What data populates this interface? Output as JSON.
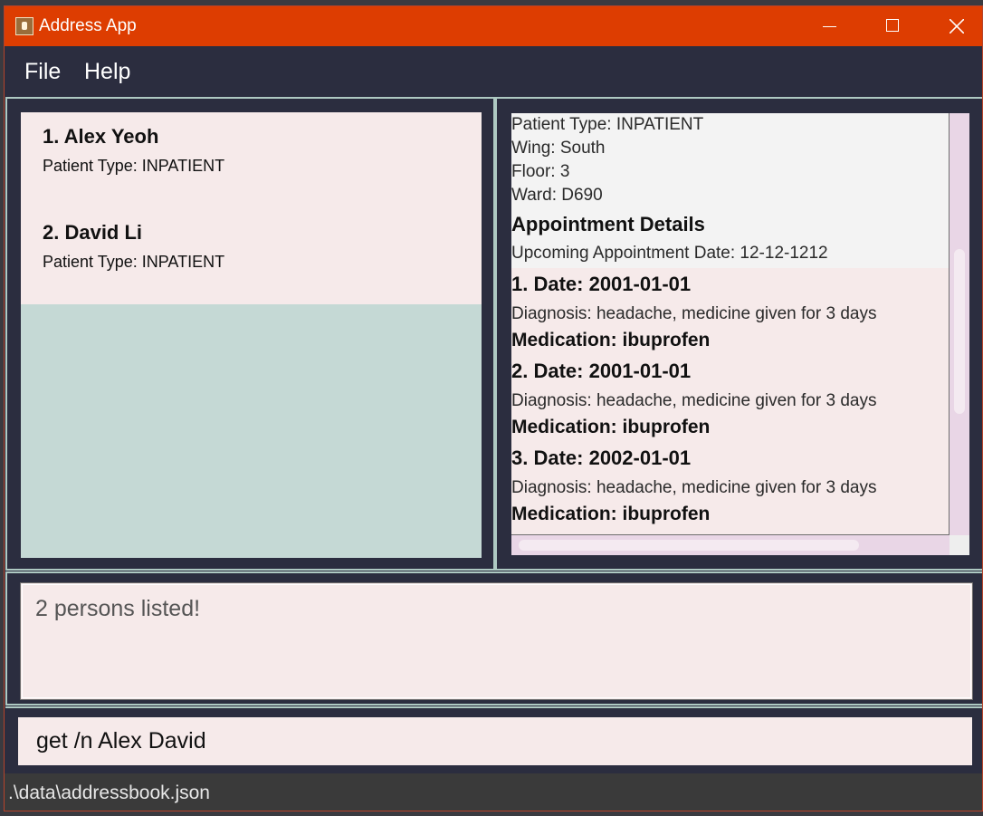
{
  "window": {
    "title": "Address App"
  },
  "menu": {
    "file": "File",
    "help": "Help"
  },
  "persons": [
    {
      "index_name": "1.  Alex Yeoh",
      "patient_type": "Patient Type: INPATIENT"
    },
    {
      "index_name": "2.  David Li",
      "patient_type": "Patient Type: INPATIENT"
    }
  ],
  "details": {
    "patient_type": "Patient Type: INPATIENT",
    "wing": "Wing: South",
    "floor": "Floor: 3",
    "ward": "Ward: D690",
    "appointment_heading": "Appointment Details",
    "upcoming": "Upcoming Appointment Date: 12-12-1212",
    "appointments": [
      {
        "date": "1. Date: 2001-01-01",
        "diagnosis": "Diagnosis: headache, medicine given for 3 days",
        "medication": "Medication: ibuprofen"
      },
      {
        "date": "2. Date: 2001-01-01",
        "diagnosis": "Diagnosis: headache, medicine given for 3 days",
        "medication": "Medication: ibuprofen"
      },
      {
        "date": "3. Date: 2002-01-01",
        "diagnosis": "Diagnosis: headache, medicine given for 3 days",
        "medication": "Medication: ibuprofen"
      }
    ]
  },
  "result": {
    "message": "2 persons listed!"
  },
  "command": {
    "value": "get /n Alex David"
  },
  "status": {
    "file_path": ".\\data\\addressbook.json"
  },
  "colors": {
    "titlebar": "#dd3d01",
    "background": "#2b2d3f",
    "card": "#f6eaea",
    "list_bg": "#c5d9d5"
  }
}
